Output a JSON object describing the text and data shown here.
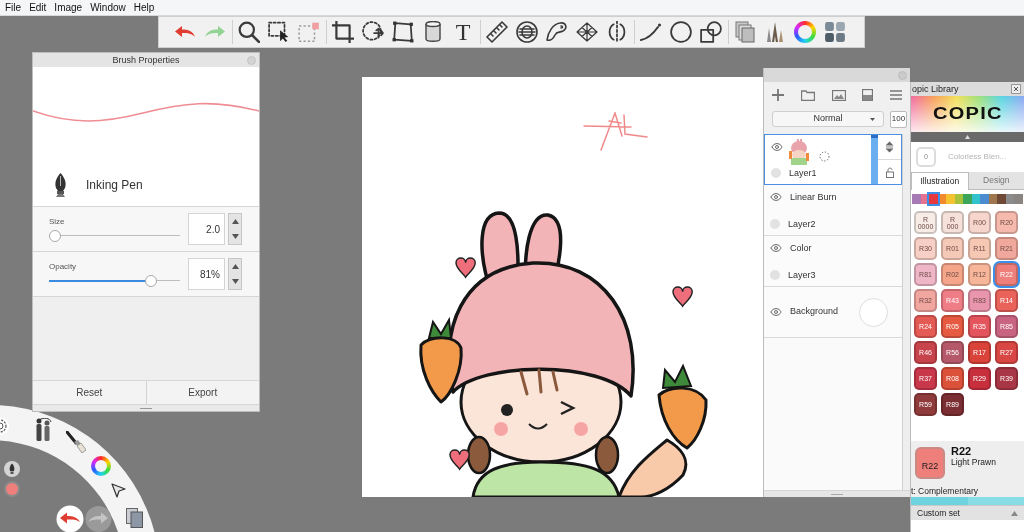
{
  "menu": [
    "File",
    "Edit",
    "Image",
    "Window",
    "Help"
  ],
  "toolbar": {
    "text_tool": "T"
  },
  "brush_properties": {
    "title": "Brush Properties",
    "brush_name": "Inking Pen",
    "sliders": [
      {
        "label": "Size",
        "level": 0,
        "value": "2.0"
      },
      {
        "label": "Opacity",
        "level": 0.81,
        "value": "81%"
      }
    ],
    "buttons": [
      "Reset",
      "Export"
    ]
  },
  "layers_panel": {
    "blend_mode": "Normal",
    "opacity": "100",
    "layers": [
      {
        "kind": "layer",
        "name": "Layer1",
        "selected": true
      },
      {
        "kind": "layer",
        "name": "Layer2",
        "blend": "Linear Burn",
        "selected": false
      },
      {
        "kind": "layer",
        "name": "Layer3",
        "blend": "Color",
        "selected": false
      },
      {
        "kind": "background",
        "name": "Background",
        "selected": false
      }
    ]
  },
  "copic_library": {
    "title": "opic Library",
    "logo": "COPIC",
    "blender": {
      "label": "0",
      "name": "Colorless Blen..."
    },
    "tabs": [
      {
        "label": "Illustration",
        "selected": true
      },
      {
        "label": "Design",
        "selected": false
      }
    ],
    "families": [
      {
        "color": "#a57ab5",
        "selected": false
      },
      {
        "color": "#e4738f",
        "selected": false
      },
      {
        "color": "#e5393f",
        "selected": true
      },
      {
        "color": "#f08a2c",
        "selected": false
      },
      {
        "color": "#f4c330",
        "selected": false
      },
      {
        "color": "#a9c23c",
        "selected": false
      },
      {
        "color": "#3ba55a",
        "selected": false
      },
      {
        "color": "#32c2cc",
        "selected": false
      },
      {
        "color": "#4a8ccf",
        "selected": false
      },
      {
        "color": "#a0764f",
        "selected": false
      },
      {
        "color": "#6e4a36",
        "selected": false
      },
      {
        "color": "#8b8b8b",
        "selected": false
      },
      {
        "color": "#8a8580",
        "selected": false
      }
    ],
    "swatches": [
      {
        "label": "R 0000",
        "color": "#f7ece6",
        "selected": false
      },
      {
        "label": "R 000",
        "color": "#f5e1da",
        "selected": false
      },
      {
        "label": "R00",
        "color": "#f6d6cc",
        "selected": false
      },
      {
        "label": "R20",
        "color": "#f5b9ad",
        "selected": false
      },
      {
        "label": "R30",
        "color": "#f7cfc4",
        "selected": false
      },
      {
        "label": "R01",
        "color": "#f5c9b8",
        "selected": false
      },
      {
        "label": "R11",
        "color": "#f6c8b4",
        "selected": false
      },
      {
        "label": "R21",
        "color": "#f0a89c",
        "selected": false
      },
      {
        "label": "R81",
        "color": "#eeb6c6",
        "selected": false
      },
      {
        "label": "R02",
        "color": "#f4a58a",
        "selected": false
      },
      {
        "label": "R12",
        "color": "#f7b699",
        "selected": false
      },
      {
        "label": "R22",
        "color": "#ef7f7b",
        "selected": true
      },
      {
        "label": "R32",
        "color": "#f1a6a0",
        "selected": false
      },
      {
        "label": "R43",
        "color": "#ef7d86",
        "selected": false
      },
      {
        "label": "R83",
        "color": "#e895ad",
        "selected": false
      },
      {
        "label": "R14",
        "color": "#e9635b",
        "selected": false
      },
      {
        "label": "R24",
        "color": "#e45a55",
        "selected": false
      },
      {
        "label": "R05",
        "color": "#e65a42",
        "selected": false
      },
      {
        "label": "R35",
        "color": "#e3545c",
        "selected": false
      },
      {
        "label": "R85",
        "color": "#c96382",
        "selected": false
      },
      {
        "label": "R46",
        "color": "#c8444c",
        "selected": false
      },
      {
        "label": "R56",
        "color": "#b5596a",
        "selected": false
      },
      {
        "label": "R17",
        "color": "#d9433a",
        "selected": false
      },
      {
        "label": "R27",
        "color": "#d84744",
        "selected": false
      },
      {
        "label": "R37",
        "color": "#c8384a",
        "selected": false
      },
      {
        "label": "R08",
        "color": "#dc513a",
        "selected": false
      },
      {
        "label": "R29",
        "color": "#c72f3d",
        "selected": false
      },
      {
        "label": "R39",
        "color": "#a93645",
        "selected": false
      },
      {
        "label": "R59",
        "color": "#8f3b3b",
        "selected": false
      },
      {
        "label": "R89",
        "color": "#7b2e33",
        "selected": false
      }
    ],
    "current": {
      "label": "R22",
      "code": "R22",
      "name": "Light Prawn"
    },
    "set_label": "t: Complementary",
    "complementary": [
      {
        "color": "#6fd3df"
      },
      {
        "color": "#88dce6"
      }
    ],
    "custom_set": "Custom set"
  }
}
